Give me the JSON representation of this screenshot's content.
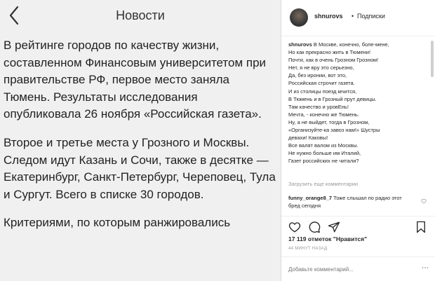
{
  "news": {
    "title": "Новости",
    "paragraphs": [
      "В рейтинге городов по качеству жизни, составленном Финансовым университетом при правительстве РФ, первое место заняла Тюмень. Результаты исследования опубликовала 26 ноября «Российская газета».",
      "Второе и третье места у Грозного и Москвы. Следом идут Казань и Сочи, также в десятке — Екатеринбург, Санкт-Петербург, Череповец, Тула и Сургут. Всего в списке 30 городов.",
      "Критериями, по которым ранжировались"
    ]
  },
  "post": {
    "username": "shnurovs",
    "separator": "•",
    "follow_label": "Подписки",
    "caption_author": "shnurovs",
    "caption_lines": [
      "В Москве, конечно, боле-мене,",
      "Но как прекрасно жить в Тюмени!",
      "Почти, как в очень Грозном Грозном!",
      "Нет, я не вру это серьезно,",
      "Да, без иронии, вот это,",
      "Российская строчит газета.",
      "И из столицы поезд мчится,",
      "В Тюмень и в Грозный прут девицы.",
      "Там качество и уровЕнь!",
      "Мечта, - конечно же Тюмень.",
      "Ну, а не выйдет, тогда в Грозном,",
      "«Организуйте-ка завоз нам!» Шустры",
      "девахи! Каковы!",
      "Все валят валом из Москвы.",
      "Не нужно больше им Италий,",
      "Газет российских не читали?"
    ],
    "load_more": "Загрузить еще комментарии",
    "comment_user": "funny_orange8_7",
    "comment_text": "Тоже слышал по радио этот бред сегодня",
    "likes": "17 119 отметок \"Нравится\"",
    "time": "44 МИНУТ НАЗАД",
    "add_comment_placeholder": "Добавьте комментарий..."
  }
}
